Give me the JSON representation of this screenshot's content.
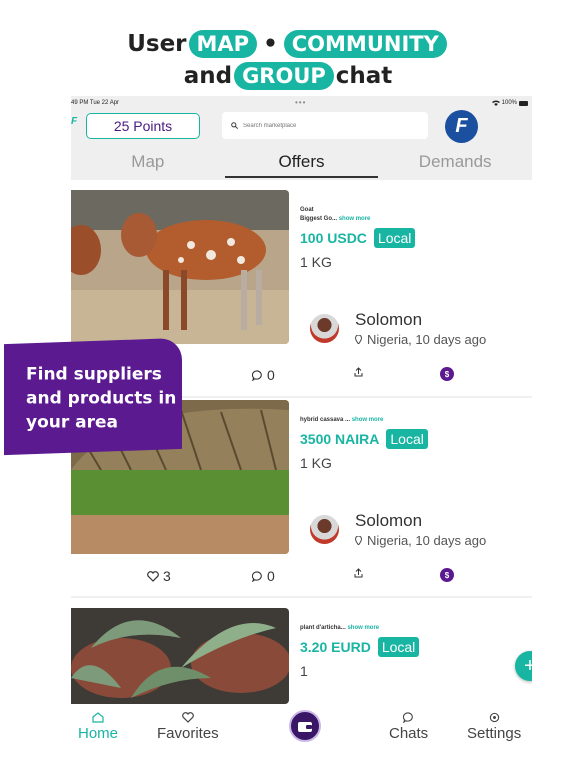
{
  "promo": {
    "line1_prefix": "User",
    "line1_pill1": "MAP",
    "line1_sep": "•",
    "line1_pill2": "COMMUNITY",
    "line2_prefix": "and",
    "line2_pill": "GROUP",
    "line2_suffix": "chat",
    "banner": "Find suppliers and products in your area"
  },
  "statusbar": {
    "time": "49 PM  Tue 22 Apr",
    "dots": "•••",
    "battery": "100%"
  },
  "topbar": {
    "logo_fragment": "F",
    "points": "25 Points",
    "search_placeholder": "Search marketplace",
    "brand_logo": "F"
  },
  "tabs": [
    {
      "label": "Map",
      "active": false
    },
    {
      "label": "Offers",
      "active": true
    },
    {
      "label": "Demands",
      "active": false
    }
  ],
  "listings": [
    {
      "category": "Goat",
      "title": "Biggest Go...",
      "show_more": "show more",
      "price": "100 USDC",
      "badge": "Local",
      "quantity": "1 KG",
      "seller": "Solomon",
      "location": "Nigeria, 10 days ago",
      "likes": "",
      "comments": "0"
    },
    {
      "category": "",
      "title": "hybrid cassava ...",
      "show_more": "show more",
      "price": "3500 NAIRA",
      "badge": "Local",
      "quantity": "1 KG",
      "seller": "Solomon",
      "location": "Nigeria, 10 days ago",
      "likes": "3",
      "comments": "0"
    },
    {
      "category": "",
      "title": "plant d'articha...",
      "show_more": "show more",
      "price": "3.20 EURD",
      "badge": "Local",
      "quantity": "1"
    }
  ],
  "fab": "+",
  "dollar_icon": "$",
  "nav": [
    {
      "label": "Home",
      "active": true
    },
    {
      "label": "Favorites",
      "active": false
    },
    {
      "label": "Chats",
      "active": false
    },
    {
      "label": "Settings",
      "active": false
    }
  ],
  "colors": {
    "accent": "#19b5a3",
    "purple": "#5b1a8f"
  }
}
